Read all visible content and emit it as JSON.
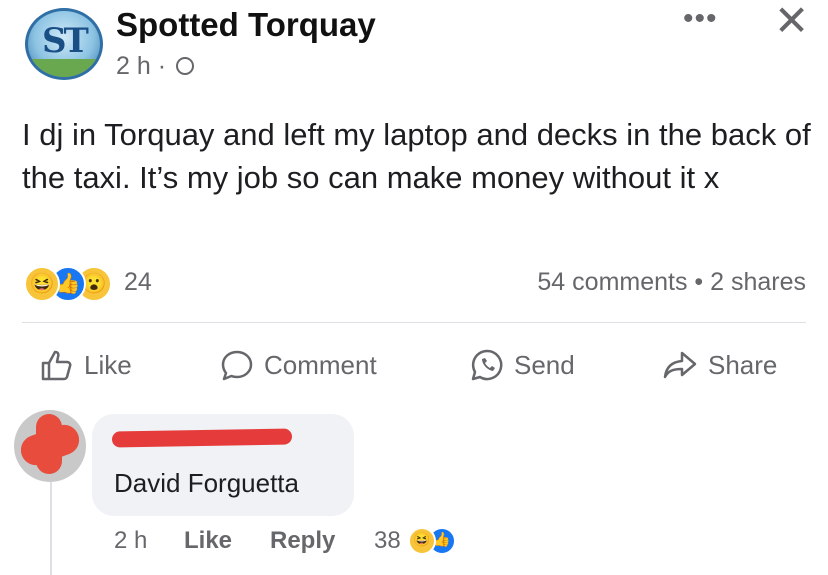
{
  "post": {
    "page_name": "Spotted Torquay",
    "time": "2 h ·",
    "privacy_icon": "globe-icon",
    "menu_icon": "more-options-icon",
    "close_icon": "close-icon",
    "text": "I dj in Torquay and left my laptop and decks in the back of the taxi. It’s my job so can make money without it x"
  },
  "reactions": {
    "types": [
      "haha",
      "like",
      "wow"
    ],
    "count": "24",
    "comments_shares": "54 comments • 2 shares"
  },
  "actions": {
    "like": "Like",
    "comment": "Comment",
    "send": "Send",
    "share": "Share"
  },
  "comment": {
    "author_redacted": true,
    "text": "David Forguetta",
    "time": "2 h",
    "like": "Like",
    "reply": "Reply",
    "reaction_count": "38",
    "reaction_types": [
      "haha",
      "like"
    ]
  },
  "colors": {
    "text": "#1c1e21",
    "muted": "#65676b",
    "like_blue": "#1877f2",
    "emoji_yellow": "#f7c43a",
    "redaction_red": "#e53b3b",
    "bubble": "#f0f2f5"
  }
}
